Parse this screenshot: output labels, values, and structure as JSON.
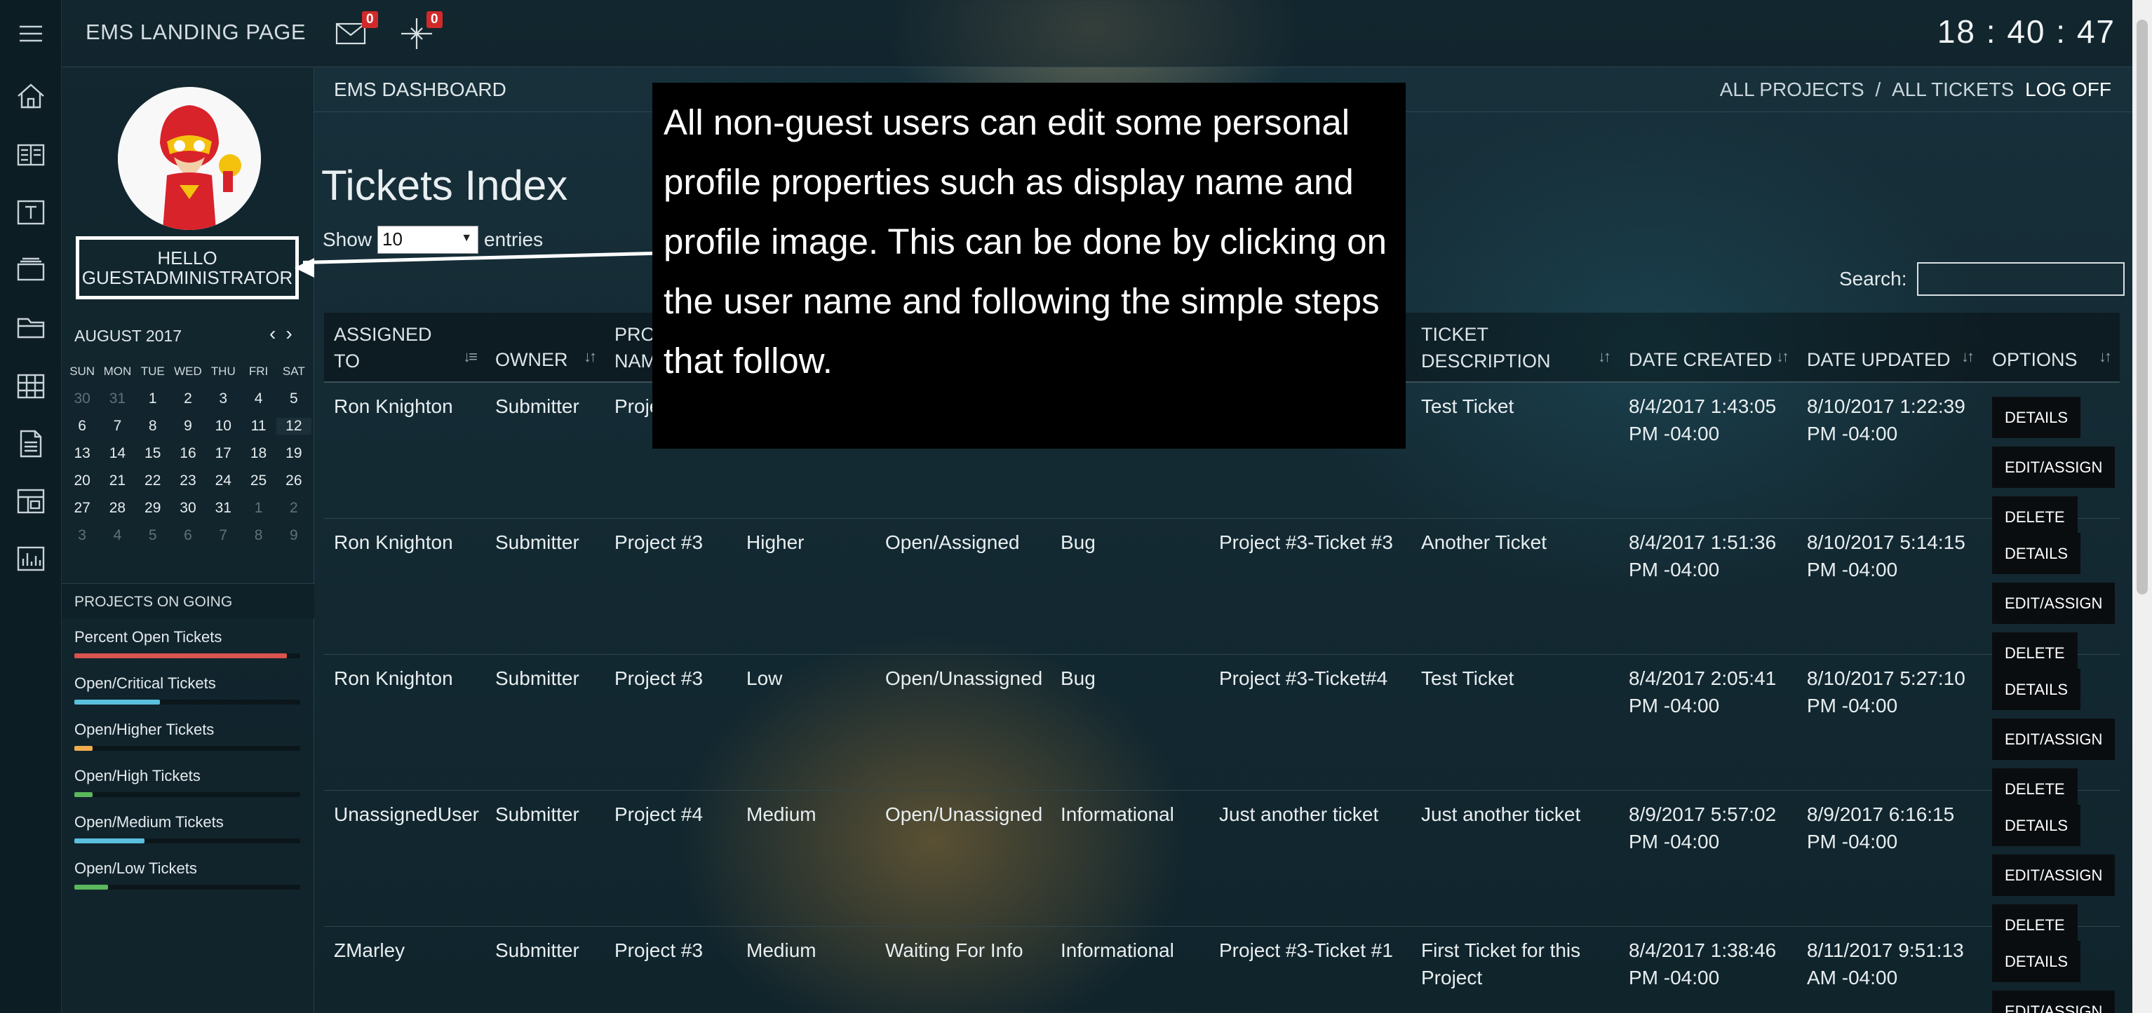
{
  "app": {
    "title": "EMS LANDING PAGE",
    "clock": "18 : 40 : 47"
  },
  "topbar": {
    "mail_badge": "0",
    "alerts_badge": "0"
  },
  "rail": [
    "home-icon",
    "board-icon",
    "text-icon",
    "stack-icon",
    "folder-icon",
    "grid-icon",
    "document-icon",
    "layout-icon",
    "bar-chart-icon"
  ],
  "user": {
    "greeting_line1": "HELLO",
    "greeting_line2": "GUESTADMINISTRATOR"
  },
  "calendar": {
    "month": "AUGUST 2017",
    "dow": [
      "SUN",
      "MON",
      "TUE",
      "WED",
      "THU",
      "FRI",
      "SAT"
    ],
    "weeks": [
      [
        "30",
        "31",
        "1",
        "2",
        "3",
        "4",
        "5"
      ],
      [
        "6",
        "7",
        "8",
        "9",
        "10",
        "11",
        "12"
      ],
      [
        "13",
        "14",
        "15",
        "16",
        "17",
        "18",
        "19"
      ],
      [
        "20",
        "21",
        "22",
        "23",
        "24",
        "25",
        "26"
      ],
      [
        "27",
        "28",
        "29",
        "30",
        "31",
        "1",
        "2"
      ],
      [
        "3",
        "4",
        "5",
        "6",
        "7",
        "8",
        "9"
      ]
    ]
  },
  "projects": {
    "heading": "PROJECTS ON GOING",
    "bars": [
      {
        "label": "Percent Open Tickets",
        "percent": 94,
        "color": "#d9534f"
      },
      {
        "label": "Open/Critical Tickets",
        "percent": 38,
        "color": "#5bc0de"
      },
      {
        "label": "Open/Higher Tickets",
        "percent": 8,
        "color": "#f0ad4e"
      },
      {
        "label": "Open/High Tickets",
        "percent": 8,
        "color": "#5cb85c"
      },
      {
        "label": "Open/Medium Tickets",
        "percent": 31,
        "color": "#5bc0de"
      },
      {
        "label": "Open/Low Tickets",
        "percent": 15,
        "color": "#5cb85c"
      }
    ]
  },
  "header": {
    "dashboard": "EMS DASHBOARD",
    "all_projects": "ALL PROJECTS",
    "separator": "/",
    "all_tickets": "ALL TICKETS",
    "log_off": "LOG OFF"
  },
  "page": {
    "title": "Tickets Index",
    "show": "Show",
    "entries_value": "10",
    "entries": "entries",
    "search_label": "Search:"
  },
  "table": {
    "headers": [
      "ASSIGNED TO",
      "OWNER",
      "PROJECT NAME",
      "",
      "",
      "",
      "",
      "TICKET DESCRIPTION",
      "DATE CREATED",
      "DATE UPDATED",
      "OPTIONS"
    ],
    "headers_visible": {
      "c1": "ASSIGNED\nTO",
      "c2": "OWNER",
      "c3": "PROJ\nNAM",
      "c8": "TICKET\nDESCRIPTION",
      "c9": "DATE CREATED",
      "c10": "DATE UPDATED",
      "c11": "OPTIONS"
    },
    "rows": [
      {
        "assigned": "Ron Knighton",
        "owner": "Submitter",
        "project": "Proje",
        "priority": "",
        "status": "",
        "type": "",
        "title": "",
        "description": "Test Ticket",
        "created": "8/4/2017 1:43:05 PM -04:00",
        "updated": "8/10/2017 1:22:39 PM -04:00"
      },
      {
        "assigned": "Ron Knighton",
        "owner": "Submitter",
        "project": "Project #3",
        "priority": "Higher",
        "status": "Open/Assigned",
        "type": "Bug",
        "title": "Project #3-Ticket #3",
        "description": "Another Ticket",
        "created": "8/4/2017 1:51:36 PM -04:00",
        "updated": "8/10/2017 5:14:15 PM -04:00"
      },
      {
        "assigned": "Ron Knighton",
        "owner": "Submitter",
        "project": "Project #3",
        "priority": "Low",
        "status": "Open/Unassigned",
        "type": "Bug",
        "title": "Project #3-Ticket#4",
        "description": "Test Ticket",
        "created": "8/4/2017 2:05:41 PM -04:00",
        "updated": "8/10/2017 5:27:10 PM -04:00"
      },
      {
        "assigned": "UnassignedUser",
        "owner": "Submitter",
        "project": "Project #4",
        "priority": "Medium",
        "status": "Open/Unassigned",
        "type": "Informational",
        "title": "Just another ticket",
        "description": "Just another ticket",
        "created": "8/9/2017 5:57:02 PM -04:00",
        "updated": "8/9/2017 6:16:15 PM -04:00"
      },
      {
        "assigned": "ZMarley",
        "owner": "Submitter",
        "project": "Project #3",
        "priority": "Medium",
        "status": "Waiting For Info",
        "type": "Informational",
        "title": "Project #3-Ticket #1",
        "description": "First Ticket for this Project",
        "created": "8/4/2017 1:38:46 PM -04:00",
        "updated": "8/11/2017 9:51:13 AM -04:00"
      }
    ],
    "options": {
      "details": "DETAILS",
      "edit": "EDIT/ASSIGN",
      "delete": "DELETE"
    }
  },
  "callout": {
    "text": "All non-guest users can edit some personal profile properties such as display name and profile image. This can be done by clicking on the user name and following the  simple steps that follow."
  }
}
